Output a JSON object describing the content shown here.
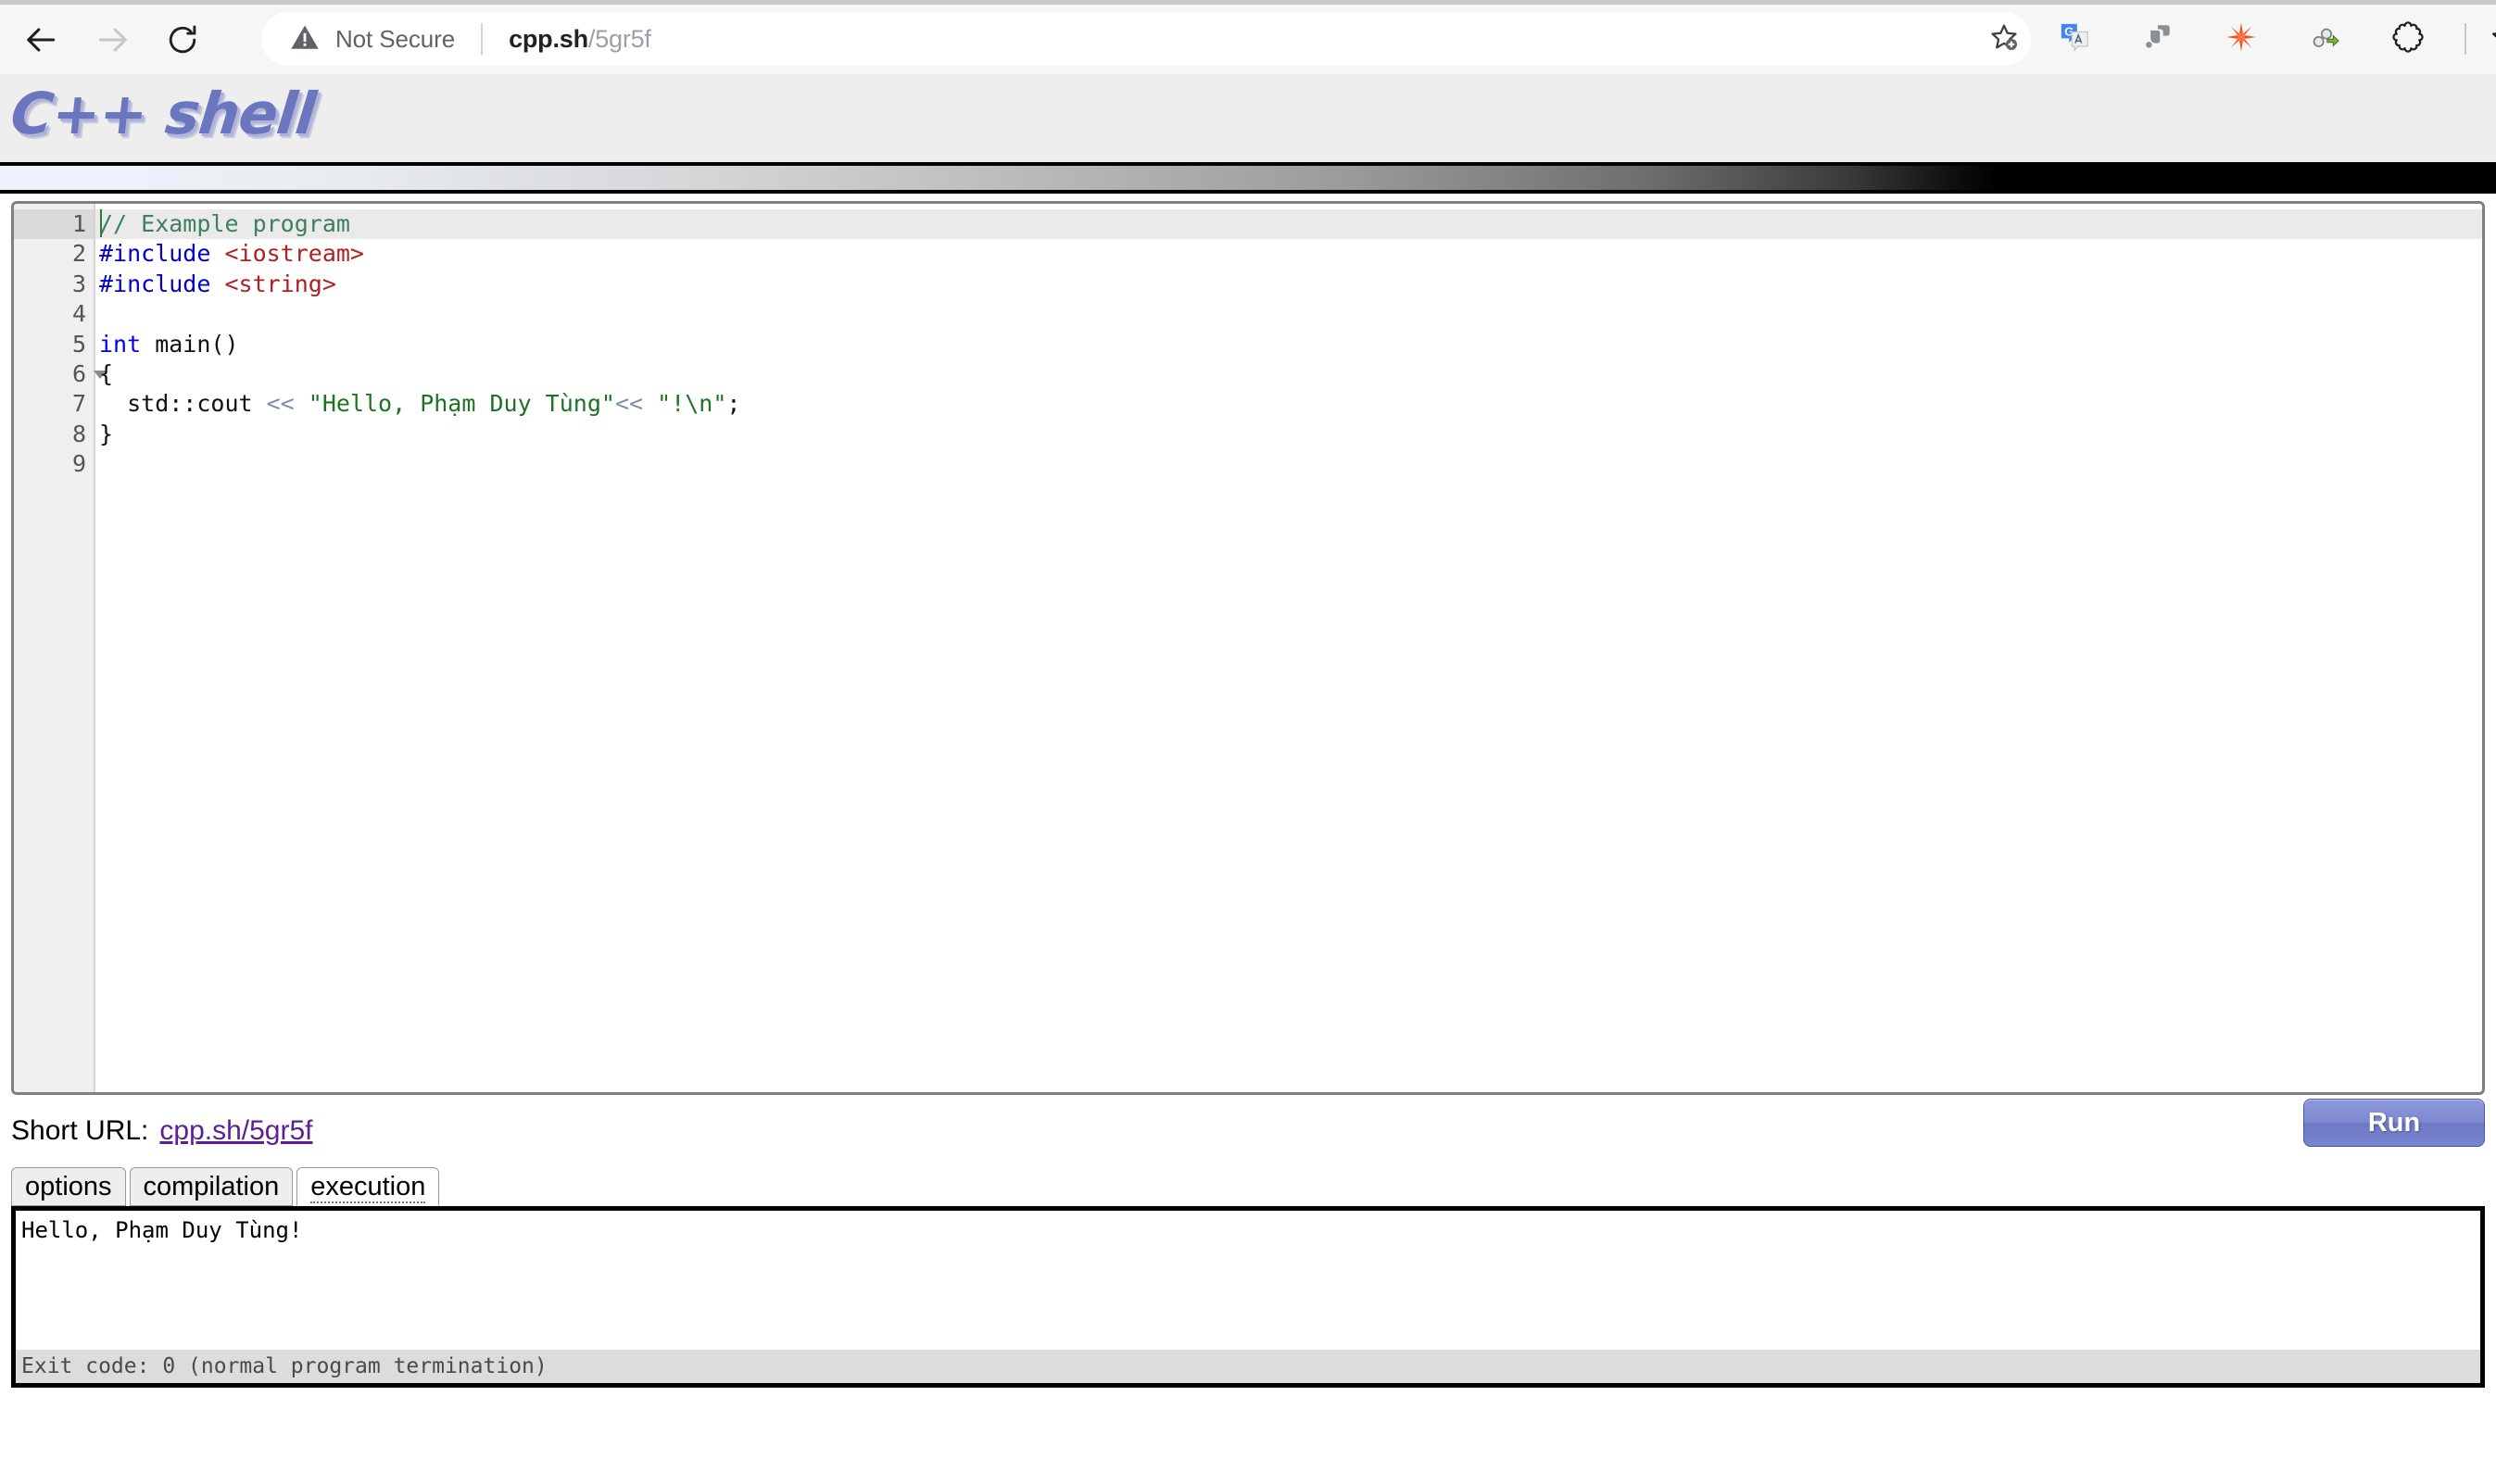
{
  "browser": {
    "back_icon": "back-arrow-icon",
    "forward_icon": "forward-arrow-icon",
    "reload_icon": "reload-icon",
    "security_label": "Not Secure",
    "security_icon": "warning-triangle-icon",
    "url_host": "cpp.sh",
    "url_path": "/5gr5f",
    "bookmark_icon": "star-plus-icon",
    "extensions": [
      {
        "name": "google-translate-icon",
        "label": "G"
      },
      {
        "name": "puzzle-gray-icon",
        "label": ""
      },
      {
        "name": "orange-starburst-icon",
        "label": ""
      },
      {
        "name": "link-share-icon",
        "label": ""
      },
      {
        "name": "extensions-puzzle-icon",
        "label": ""
      },
      {
        "name": "collections-star-icon",
        "label": ""
      }
    ]
  },
  "site": {
    "logo_text": "C++ shell"
  },
  "editor": {
    "line_numbers": [
      "1",
      "2",
      "3",
      "4",
      "5",
      "6",
      "7",
      "8",
      "9"
    ],
    "active_line": 1,
    "fold_line": 6,
    "lines": [
      {
        "n": "1",
        "tokens": [
          {
            "t": "// Example program",
            "c": "tok-comment"
          }
        ]
      },
      {
        "n": "2",
        "tokens": [
          {
            "t": "#include ",
            "c": "tok-pre"
          },
          {
            "t": "<iostream>",
            "c": "tok-header"
          }
        ]
      },
      {
        "n": "3",
        "tokens": [
          {
            "t": "#include ",
            "c": "tok-pre"
          },
          {
            "t": "<string>",
            "c": "tok-header"
          }
        ]
      },
      {
        "n": "4",
        "tokens": [
          {
            "t": "",
            "c": "tok-plain"
          }
        ]
      },
      {
        "n": "5",
        "tokens": [
          {
            "t": "int",
            "c": "tok-key"
          },
          {
            "t": " main()",
            "c": "tok-plain"
          }
        ]
      },
      {
        "n": "6",
        "tokens": [
          {
            "t": "{",
            "c": "tok-plain"
          }
        ]
      },
      {
        "n": "7",
        "tokens": [
          {
            "t": "  std::cout ",
            "c": "tok-plain"
          },
          {
            "t": "<<",
            "c": "tok-op"
          },
          {
            "t": " ",
            "c": "tok-plain"
          },
          {
            "t": "\"Hello, Phạm Duy Tùng\"",
            "c": "tok-str"
          },
          {
            "t": "<<",
            "c": "tok-op"
          },
          {
            "t": " ",
            "c": "tok-plain"
          },
          {
            "t": "\"!\\n\"",
            "c": "tok-str"
          },
          {
            "t": ";",
            "c": "tok-plain"
          }
        ]
      },
      {
        "n": "8",
        "tokens": [
          {
            "t": "}",
            "c": "tok-plain"
          }
        ]
      },
      {
        "n": "9",
        "tokens": [
          {
            "t": "",
            "c": "tok-plain"
          }
        ]
      }
    ]
  },
  "footer": {
    "short_url_label": "Short URL:",
    "short_url_link": "cpp.sh/5gr5f",
    "run_label": "Run"
  },
  "tabs": [
    {
      "label": "options",
      "active": false
    },
    {
      "label": "compilation",
      "active": false
    },
    {
      "label": "execution",
      "active": true
    }
  ],
  "output": {
    "text": "Hello, Phạm Duy Tùng!",
    "exit_status": "Exit code: 0 (normal program termination)"
  },
  "colors": {
    "logo": "#6c76bf",
    "run_button": "#7e89d0",
    "link_visited": "#5c1f94",
    "comment": "#3f7f5f",
    "preprocessor": "#0000cc",
    "header_include": "#b02020",
    "keyword": "#0000ee",
    "string": "#1d7324"
  }
}
